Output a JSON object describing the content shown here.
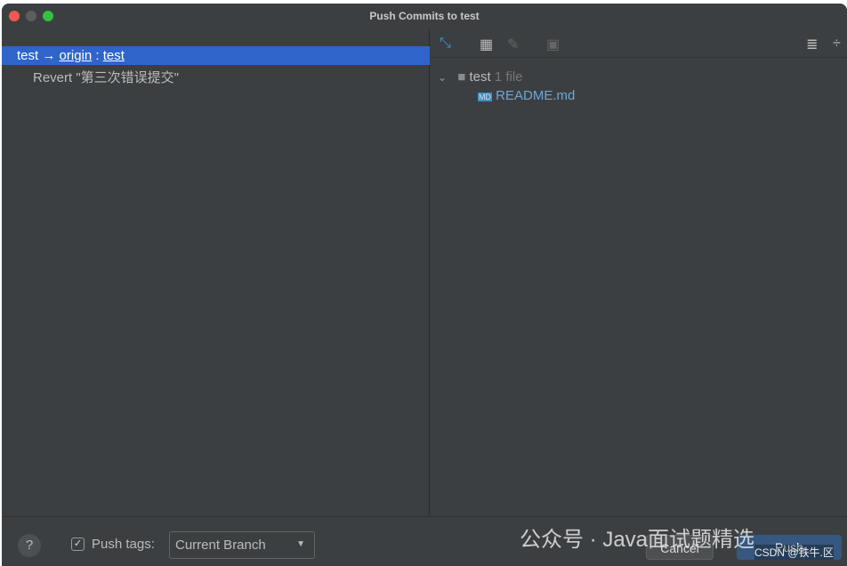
{
  "window": {
    "title": "Push Commits to test"
  },
  "left": {
    "branch": {
      "local": "test",
      "arrow": "→",
      "remote": "origin",
      "sep": ":",
      "remote_branch": "test"
    },
    "commit": "Revert \"第三次错误提交\""
  },
  "right": {
    "folder": {
      "name": "test",
      "count": "1 file"
    },
    "file": "README.md",
    "file_badge": "MD"
  },
  "bottom": {
    "help": "?",
    "push_tags_checked": true,
    "push_tags_label": "Push tags:",
    "push_tags_value": "Current Branch",
    "cancel": "Cancel",
    "push": "Push"
  },
  "watermarks": {
    "wechat": "公众号 · Java面试题精选",
    "csdn": "CSDN @铁牛.区"
  },
  "colors": {
    "selection": "#2f65ca",
    "file": "#6ea6d8",
    "background": "#3c3f41"
  }
}
